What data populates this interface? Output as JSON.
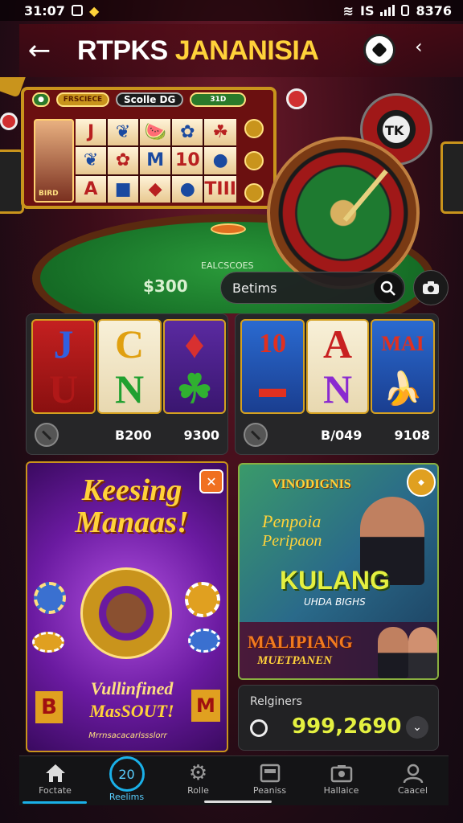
{
  "status_bar": {
    "time": "31:07",
    "battery": "8376",
    "signal_label": "IS"
  },
  "header": {
    "title_white": "RTPKS",
    "title_yellow": "JANANISIA"
  },
  "scene": {
    "slot_pill_left": "FRSCIECE",
    "slot_pill_center": "Scolle DG",
    "slot_pill_right": "31D",
    "face_label": "BIRD",
    "reels": [
      "J",
      "❦",
      "🍉",
      "✿",
      "☘",
      "❦",
      "✿",
      "M",
      "10",
      "●",
      "A",
      "■",
      "◆",
      "●",
      "TIII"
    ],
    "wheel_top": "TK",
    "table_amount": "$300",
    "table_small": "EALCSCOES"
  },
  "search": {
    "placeholder": "Betims"
  },
  "cards": {
    "slot1": {
      "reels": [
        [
          "J",
          "U"
        ],
        [
          "C",
          "N"
        ],
        [
          "♦",
          "☘"
        ]
      ],
      "value_left": "B200",
      "value_right": "9300"
    },
    "slot2": {
      "reels": [
        [
          "10",
          "▬"
        ],
        [
          "A",
          "N"
        ],
        [
          "MAI",
          "🍌"
        ]
      ],
      "value_left": "B/049",
      "value_right": "9108"
    }
  },
  "promo1": {
    "headline": "Keesing Manaas!",
    "subline": "Vullinfined",
    "subline2": "MasSOUT!",
    "footer": "Mrrnsacacarlssslorr"
  },
  "promo2": {
    "top": "VINODIGNIS",
    "line1": "Penpoia",
    "line2": "Peripaon",
    "big": "KULANG",
    "small": "UHDA BIGHS",
    "bottom1": "MALIPIANG",
    "bottom2": "MUETPANEN"
  },
  "balance": {
    "label": "Relginers",
    "amount": "999,2690"
  },
  "nav": [
    {
      "label": "Foctate",
      "icon": "home-icon"
    },
    {
      "label": "Reelims",
      "icon": "badge-icon",
      "badge": "20"
    },
    {
      "label": "Rolle",
      "icon": "gear-icon"
    },
    {
      "label": "Peaniss",
      "icon": "card-icon"
    },
    {
      "label": "Hallaice",
      "icon": "camera-icon"
    },
    {
      "label": "Caacel",
      "icon": "user-icon"
    }
  ],
  "colors": {
    "accent": "#1ab0e8",
    "title_yellow": "#ffd23a",
    "balance_green": "#e4f040"
  }
}
